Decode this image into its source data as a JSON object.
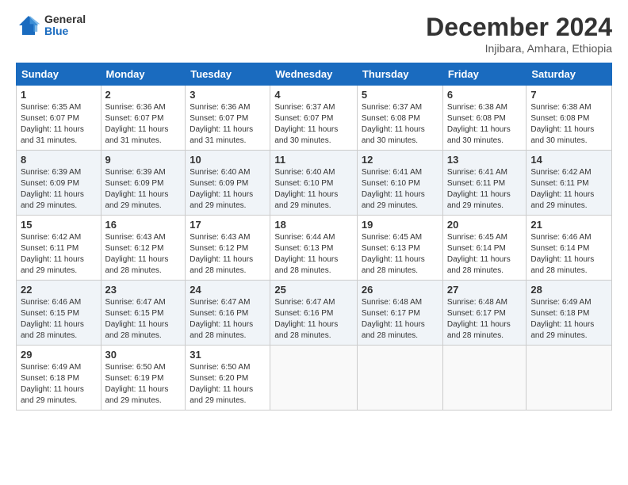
{
  "logo": {
    "general": "General",
    "blue": "Blue"
  },
  "title": "December 2024",
  "location": "Injibara, Amhara, Ethiopia",
  "days_header": [
    "Sunday",
    "Monday",
    "Tuesday",
    "Wednesday",
    "Thursday",
    "Friday",
    "Saturday"
  ],
  "weeks": [
    [
      {
        "day": "1",
        "sunrise": "6:35 AM",
        "sunset": "6:07 PM",
        "daylight": "11 hours and 31 minutes."
      },
      {
        "day": "2",
        "sunrise": "6:36 AM",
        "sunset": "6:07 PM",
        "daylight": "11 hours and 31 minutes."
      },
      {
        "day": "3",
        "sunrise": "6:36 AM",
        "sunset": "6:07 PM",
        "daylight": "11 hours and 31 minutes."
      },
      {
        "day": "4",
        "sunrise": "6:37 AM",
        "sunset": "6:07 PM",
        "daylight": "11 hours and 30 minutes."
      },
      {
        "day": "5",
        "sunrise": "6:37 AM",
        "sunset": "6:08 PM",
        "daylight": "11 hours and 30 minutes."
      },
      {
        "day": "6",
        "sunrise": "6:38 AM",
        "sunset": "6:08 PM",
        "daylight": "11 hours and 30 minutes."
      },
      {
        "day": "7",
        "sunrise": "6:38 AM",
        "sunset": "6:08 PM",
        "daylight": "11 hours and 30 minutes."
      }
    ],
    [
      {
        "day": "8",
        "sunrise": "6:39 AM",
        "sunset": "6:09 PM",
        "daylight": "11 hours and 29 minutes."
      },
      {
        "day": "9",
        "sunrise": "6:39 AM",
        "sunset": "6:09 PM",
        "daylight": "11 hours and 29 minutes."
      },
      {
        "day": "10",
        "sunrise": "6:40 AM",
        "sunset": "6:09 PM",
        "daylight": "11 hours and 29 minutes."
      },
      {
        "day": "11",
        "sunrise": "6:40 AM",
        "sunset": "6:10 PM",
        "daylight": "11 hours and 29 minutes."
      },
      {
        "day": "12",
        "sunrise": "6:41 AM",
        "sunset": "6:10 PM",
        "daylight": "11 hours and 29 minutes."
      },
      {
        "day": "13",
        "sunrise": "6:41 AM",
        "sunset": "6:11 PM",
        "daylight": "11 hours and 29 minutes."
      },
      {
        "day": "14",
        "sunrise": "6:42 AM",
        "sunset": "6:11 PM",
        "daylight": "11 hours and 29 minutes."
      }
    ],
    [
      {
        "day": "15",
        "sunrise": "6:42 AM",
        "sunset": "6:11 PM",
        "daylight": "11 hours and 29 minutes."
      },
      {
        "day": "16",
        "sunrise": "6:43 AM",
        "sunset": "6:12 PM",
        "daylight": "11 hours and 28 minutes."
      },
      {
        "day": "17",
        "sunrise": "6:43 AM",
        "sunset": "6:12 PM",
        "daylight": "11 hours and 28 minutes."
      },
      {
        "day": "18",
        "sunrise": "6:44 AM",
        "sunset": "6:13 PM",
        "daylight": "11 hours and 28 minutes."
      },
      {
        "day": "19",
        "sunrise": "6:45 AM",
        "sunset": "6:13 PM",
        "daylight": "11 hours and 28 minutes."
      },
      {
        "day": "20",
        "sunrise": "6:45 AM",
        "sunset": "6:14 PM",
        "daylight": "11 hours and 28 minutes."
      },
      {
        "day": "21",
        "sunrise": "6:46 AM",
        "sunset": "6:14 PM",
        "daylight": "11 hours and 28 minutes."
      }
    ],
    [
      {
        "day": "22",
        "sunrise": "6:46 AM",
        "sunset": "6:15 PM",
        "daylight": "11 hours and 28 minutes."
      },
      {
        "day": "23",
        "sunrise": "6:47 AM",
        "sunset": "6:15 PM",
        "daylight": "11 hours and 28 minutes."
      },
      {
        "day": "24",
        "sunrise": "6:47 AM",
        "sunset": "6:16 PM",
        "daylight": "11 hours and 28 minutes."
      },
      {
        "day": "25",
        "sunrise": "6:47 AM",
        "sunset": "6:16 PM",
        "daylight": "11 hours and 28 minutes."
      },
      {
        "day": "26",
        "sunrise": "6:48 AM",
        "sunset": "6:17 PM",
        "daylight": "11 hours and 28 minutes."
      },
      {
        "day": "27",
        "sunrise": "6:48 AM",
        "sunset": "6:17 PM",
        "daylight": "11 hours and 28 minutes."
      },
      {
        "day": "28",
        "sunrise": "6:49 AM",
        "sunset": "6:18 PM",
        "daylight": "11 hours and 29 minutes."
      }
    ],
    [
      {
        "day": "29",
        "sunrise": "6:49 AM",
        "sunset": "6:18 PM",
        "daylight": "11 hours and 29 minutes."
      },
      {
        "day": "30",
        "sunrise": "6:50 AM",
        "sunset": "6:19 PM",
        "daylight": "11 hours and 29 minutes."
      },
      {
        "day": "31",
        "sunrise": "6:50 AM",
        "sunset": "6:20 PM",
        "daylight": "11 hours and 29 minutes."
      },
      null,
      null,
      null,
      null
    ]
  ]
}
